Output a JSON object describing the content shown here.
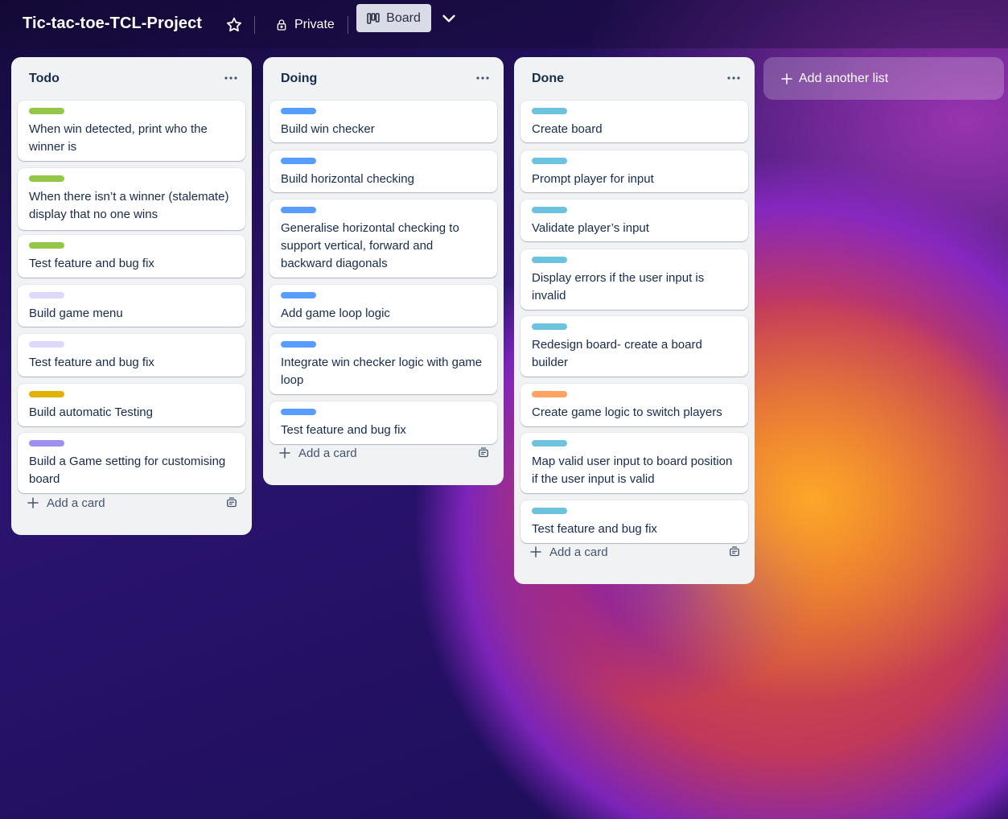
{
  "header": {
    "board_title": "Tic-tac-toe-TCL-Project",
    "visibility": "Private",
    "view_button": "Board"
  },
  "colors": {
    "green": "#94c748",
    "lavender": "#dfd8fd",
    "yellow": "#e2b203",
    "purple": "#9f8fef",
    "blue": "#579dff",
    "teal": "#6cc3e0",
    "orange": "#fea362"
  },
  "lists": [
    {
      "title": "Todo",
      "add_card": "Add a card",
      "cards": [
        {
          "label": "green",
          "text": "When win detected, print who the winner is"
        },
        {
          "label": "green",
          "text": "When there isn’t a winner (stalemate) display that no one wins"
        },
        {
          "label": "green",
          "text": "Test feature and bug fix"
        },
        {
          "label": "lavender",
          "text": "Build game menu"
        },
        {
          "label": "lavender",
          "text": "Test feature and bug fix"
        },
        {
          "label": "yellow",
          "text": "Build automatic Testing"
        },
        {
          "label": "purple",
          "text": "Build a Game setting for customising board"
        }
      ]
    },
    {
      "title": "Doing",
      "add_card": "Add a card",
      "cards": [
        {
          "label": "blue",
          "text": "Build win checker"
        },
        {
          "label": "blue",
          "text": "Build horizontal checking"
        },
        {
          "label": "blue",
          "text": "Generalise horizontal checking to support vertical, forward and backward diagonals"
        },
        {
          "label": "blue",
          "text": "Add game loop logic"
        },
        {
          "label": "blue",
          "text": "Integrate win checker logic with game loop"
        },
        {
          "label": "blue",
          "text": "Test feature and bug fix"
        }
      ]
    },
    {
      "title": "Done",
      "add_card": "Add a card",
      "cards": [
        {
          "label": "teal",
          "text": "Create board"
        },
        {
          "label": "teal",
          "text": "Prompt player for input"
        },
        {
          "label": "teal",
          "text": "Validate player’s input"
        },
        {
          "label": "teal",
          "text": "Display errors if the user input is invalid"
        },
        {
          "label": "teal",
          "text": "Redesign board- create a board builder"
        },
        {
          "label": "orange",
          "text": "Create game logic to switch players"
        },
        {
          "label": "teal",
          "text": "Map valid user input to board position if the user input is valid"
        },
        {
          "label": "teal",
          "text": "Test feature and bug fix"
        }
      ]
    }
  ],
  "add_list": "Add another list"
}
